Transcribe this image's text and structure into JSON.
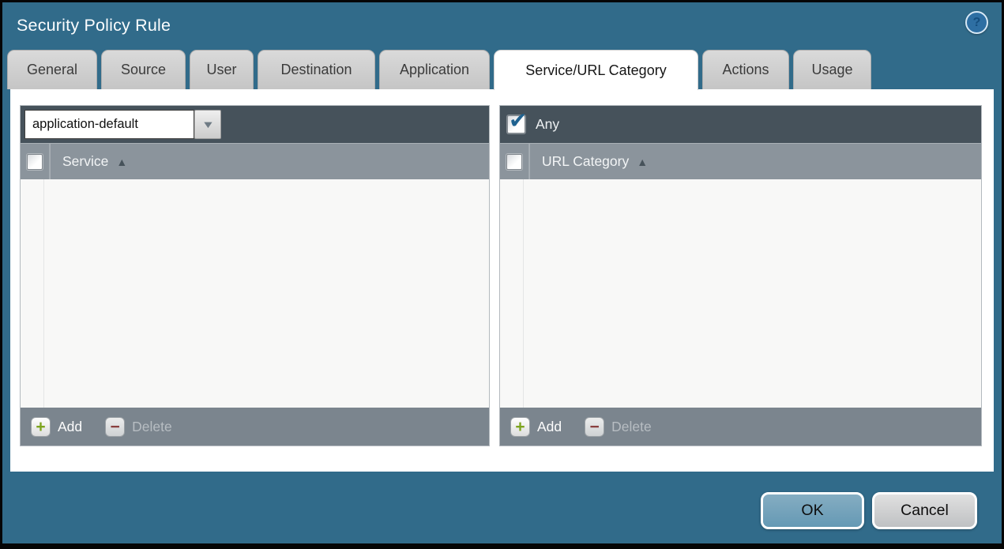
{
  "window": {
    "title": "Security Policy Rule"
  },
  "tabs": [
    {
      "label": "General",
      "active": false
    },
    {
      "label": "Source",
      "active": false
    },
    {
      "label": "User",
      "active": false
    },
    {
      "label": "Destination",
      "active": false
    },
    {
      "label": "Application",
      "active": false
    },
    {
      "label": "Service/URL Category",
      "active": true
    },
    {
      "label": "Actions",
      "active": false
    },
    {
      "label": "Usage",
      "active": false
    }
  ],
  "service_panel": {
    "dropdown_value": "application-default",
    "column_header": "Service",
    "rows": [],
    "add_label": "Add",
    "delete_label": "Delete",
    "delete_enabled": false
  },
  "url_panel": {
    "any_label": "Any",
    "any_checked": true,
    "column_header": "URL Category",
    "rows": [],
    "add_label": "Add",
    "delete_label": "Delete",
    "delete_enabled": false
  },
  "dialog_buttons": {
    "ok_label": "OK",
    "cancel_label": "Cancel"
  },
  "icons": {
    "help": "?",
    "dropdown_arrow": "▼",
    "sort_asc": "▲",
    "check": "✔",
    "add": "+",
    "delete": "−"
  },
  "colors": {
    "dialog_background": "#316b8a",
    "toolbar_dark": "#46525b",
    "header_gray": "#8b949c",
    "footer_gray": "#7b858e",
    "ok_button": "#6fa0ba",
    "cancel_button": "#c9c9c9",
    "add_icon_green": "#7da41e",
    "delete_icon_red": "#8a4040",
    "check_blue": "#1f6290"
  }
}
